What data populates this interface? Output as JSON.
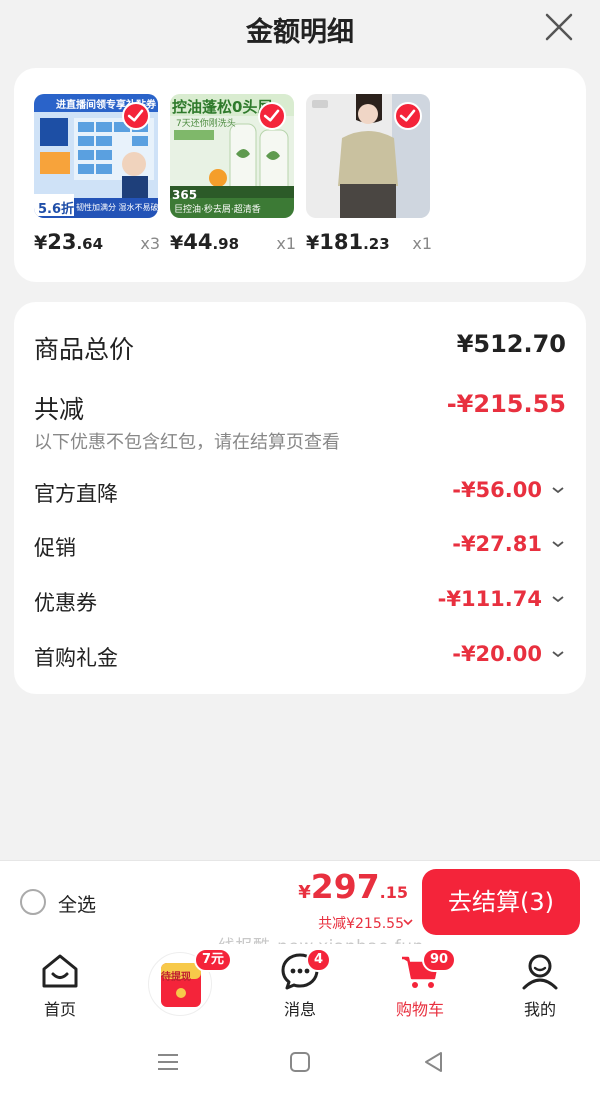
{
  "header": {
    "title": "金额明细"
  },
  "products": [
    {
      "yen": "¥",
      "int": "23",
      "dec": ".64",
      "qty": "x3",
      "image_text": "进直播间领专享补贴券",
      "tag": "5.6折",
      "desc": "韧性加满分 湿水不易破"
    },
    {
      "yen": "¥",
      "int": "44",
      "dec": ".98",
      "qty": "x1",
      "image_text": "控油蓬松0头屑",
      "sub": "7天还你刚洗头",
      "tag": "365",
      "desc": "巨控油·秒去屑·超清香"
    },
    {
      "yen": "¥",
      "int": "181",
      "dec": ".23",
      "qty": "x1"
    }
  ],
  "summary": {
    "total_label": "商品总价",
    "total_value": "¥512.70",
    "reduce_label": "共减",
    "reduce_value": "-¥215.55",
    "note": "以下优惠不包含红包，请在结算页查看",
    "items": [
      {
        "label": "官方直降",
        "value": "-¥56.00"
      },
      {
        "label": "促销",
        "value": "-¥27.81"
      },
      {
        "label": "优惠券",
        "value": "-¥111.74"
      },
      {
        "label": "首购礼金",
        "value": "-¥20.00"
      }
    ]
  },
  "checkout": {
    "select_all": "全选",
    "total_yen": "¥",
    "total_int": "297",
    "total_dec": ".15",
    "saved": "共减¥215.55",
    "pay_button": "去结算(3)"
  },
  "watermark": "线报酷-new.xianbao.fun",
  "tabbar": {
    "home": "首页",
    "promo_label": "待提现",
    "promo_badge": "7元",
    "messages": "消息",
    "messages_badge": "4",
    "cart": "购物车",
    "cart_badge": "90",
    "me": "我的"
  },
  "colors": {
    "accent": "#f4243a",
    "price_red": "#e8303f",
    "background": "#f2f2f2"
  }
}
